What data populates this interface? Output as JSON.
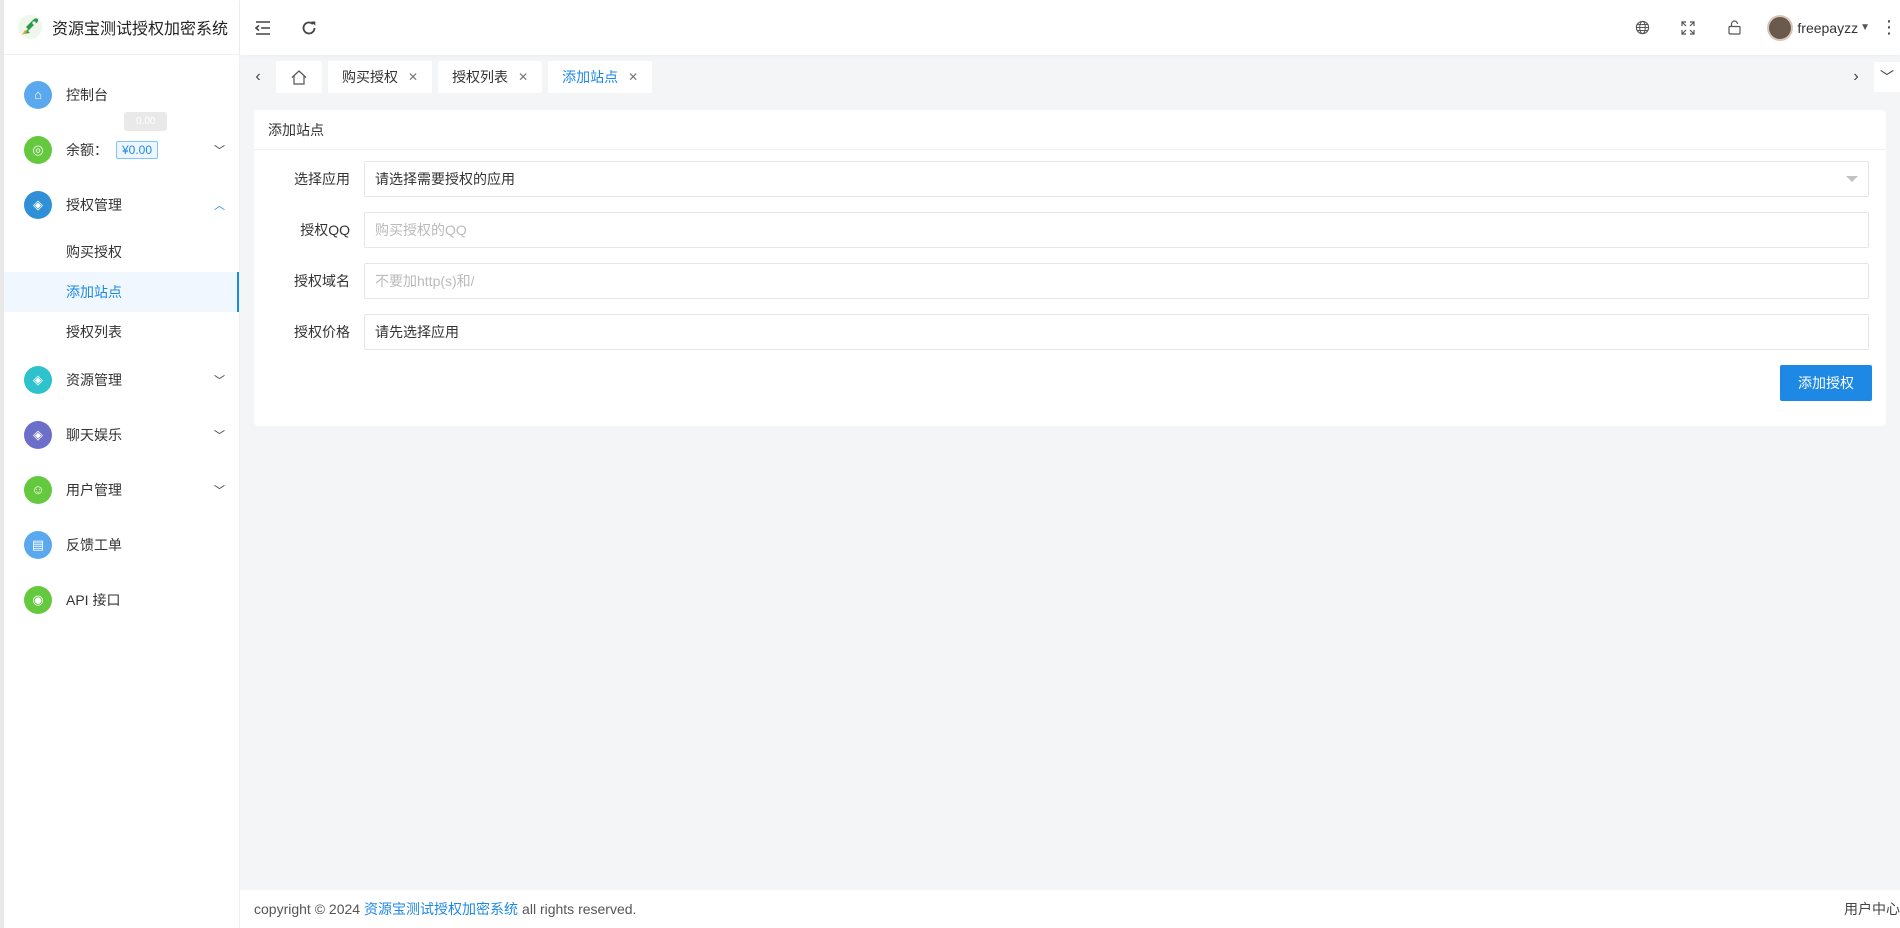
{
  "app": {
    "title": "资源宝测试授权加密系统"
  },
  "sidebar": {
    "items": [
      {
        "label": "控制台",
        "color": "#5aa9ee"
      },
      {
        "label": "余额：",
        "color": "#64c93e",
        "badge": "¥0.00",
        "tooltip": "0.00"
      },
      {
        "label": "授权管理",
        "color": "#2f8fd7",
        "sub": [
          "购买授权",
          "添加站点",
          "授权列表"
        ]
      },
      {
        "label": "资源管理",
        "color": "#2ec3cc"
      },
      {
        "label": "聊天娱乐",
        "color": "#6c6fc9"
      },
      {
        "label": "用户管理",
        "color": "#64c93e"
      },
      {
        "label": "反馈工单",
        "color": "#5aa9ee"
      },
      {
        "label": "API 接口",
        "color": "#64c93e"
      }
    ]
  },
  "header": {
    "username": "freepayzz"
  },
  "tabs": {
    "items": [
      "购买授权",
      "授权列表",
      "添加站点"
    ],
    "active": "添加站点"
  },
  "card": {
    "title": "添加站点",
    "fields": [
      {
        "label": "选择应用",
        "value": "请选择需要授权的应用"
      },
      {
        "label": "授权QQ",
        "placeholder": "购买授权的QQ"
      },
      {
        "label": "授权域名",
        "placeholder": "不要加http(s)和/"
      },
      {
        "label": "授权价格",
        "value": "请先选择应用"
      }
    ],
    "submit_label": "添加授权"
  },
  "footer": {
    "copyright": "copyright © 2024",
    "link": "资源宝测试授权加密系统",
    "suffix": "all rights reserved.",
    "right": "用户中心"
  },
  "colors": {
    "accent": "#1e88e5"
  }
}
